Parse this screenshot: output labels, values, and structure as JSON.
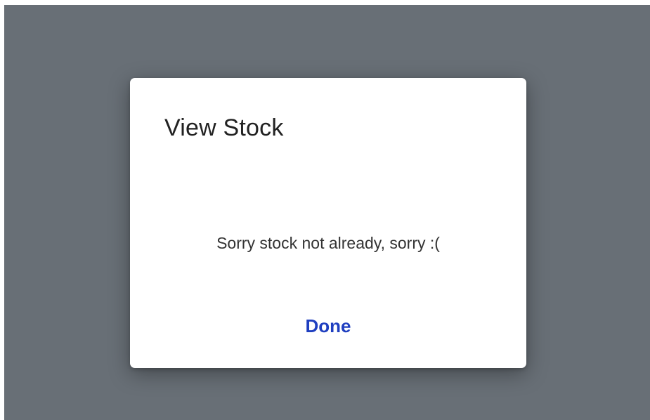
{
  "dialog": {
    "title": "View Stock",
    "message": "Sorry stock not already, sorry :(",
    "done_label": "Done"
  },
  "colors": {
    "overlay": "#686f76",
    "dialog_background": "#ffffff",
    "button_text": "#1f3fc0"
  }
}
